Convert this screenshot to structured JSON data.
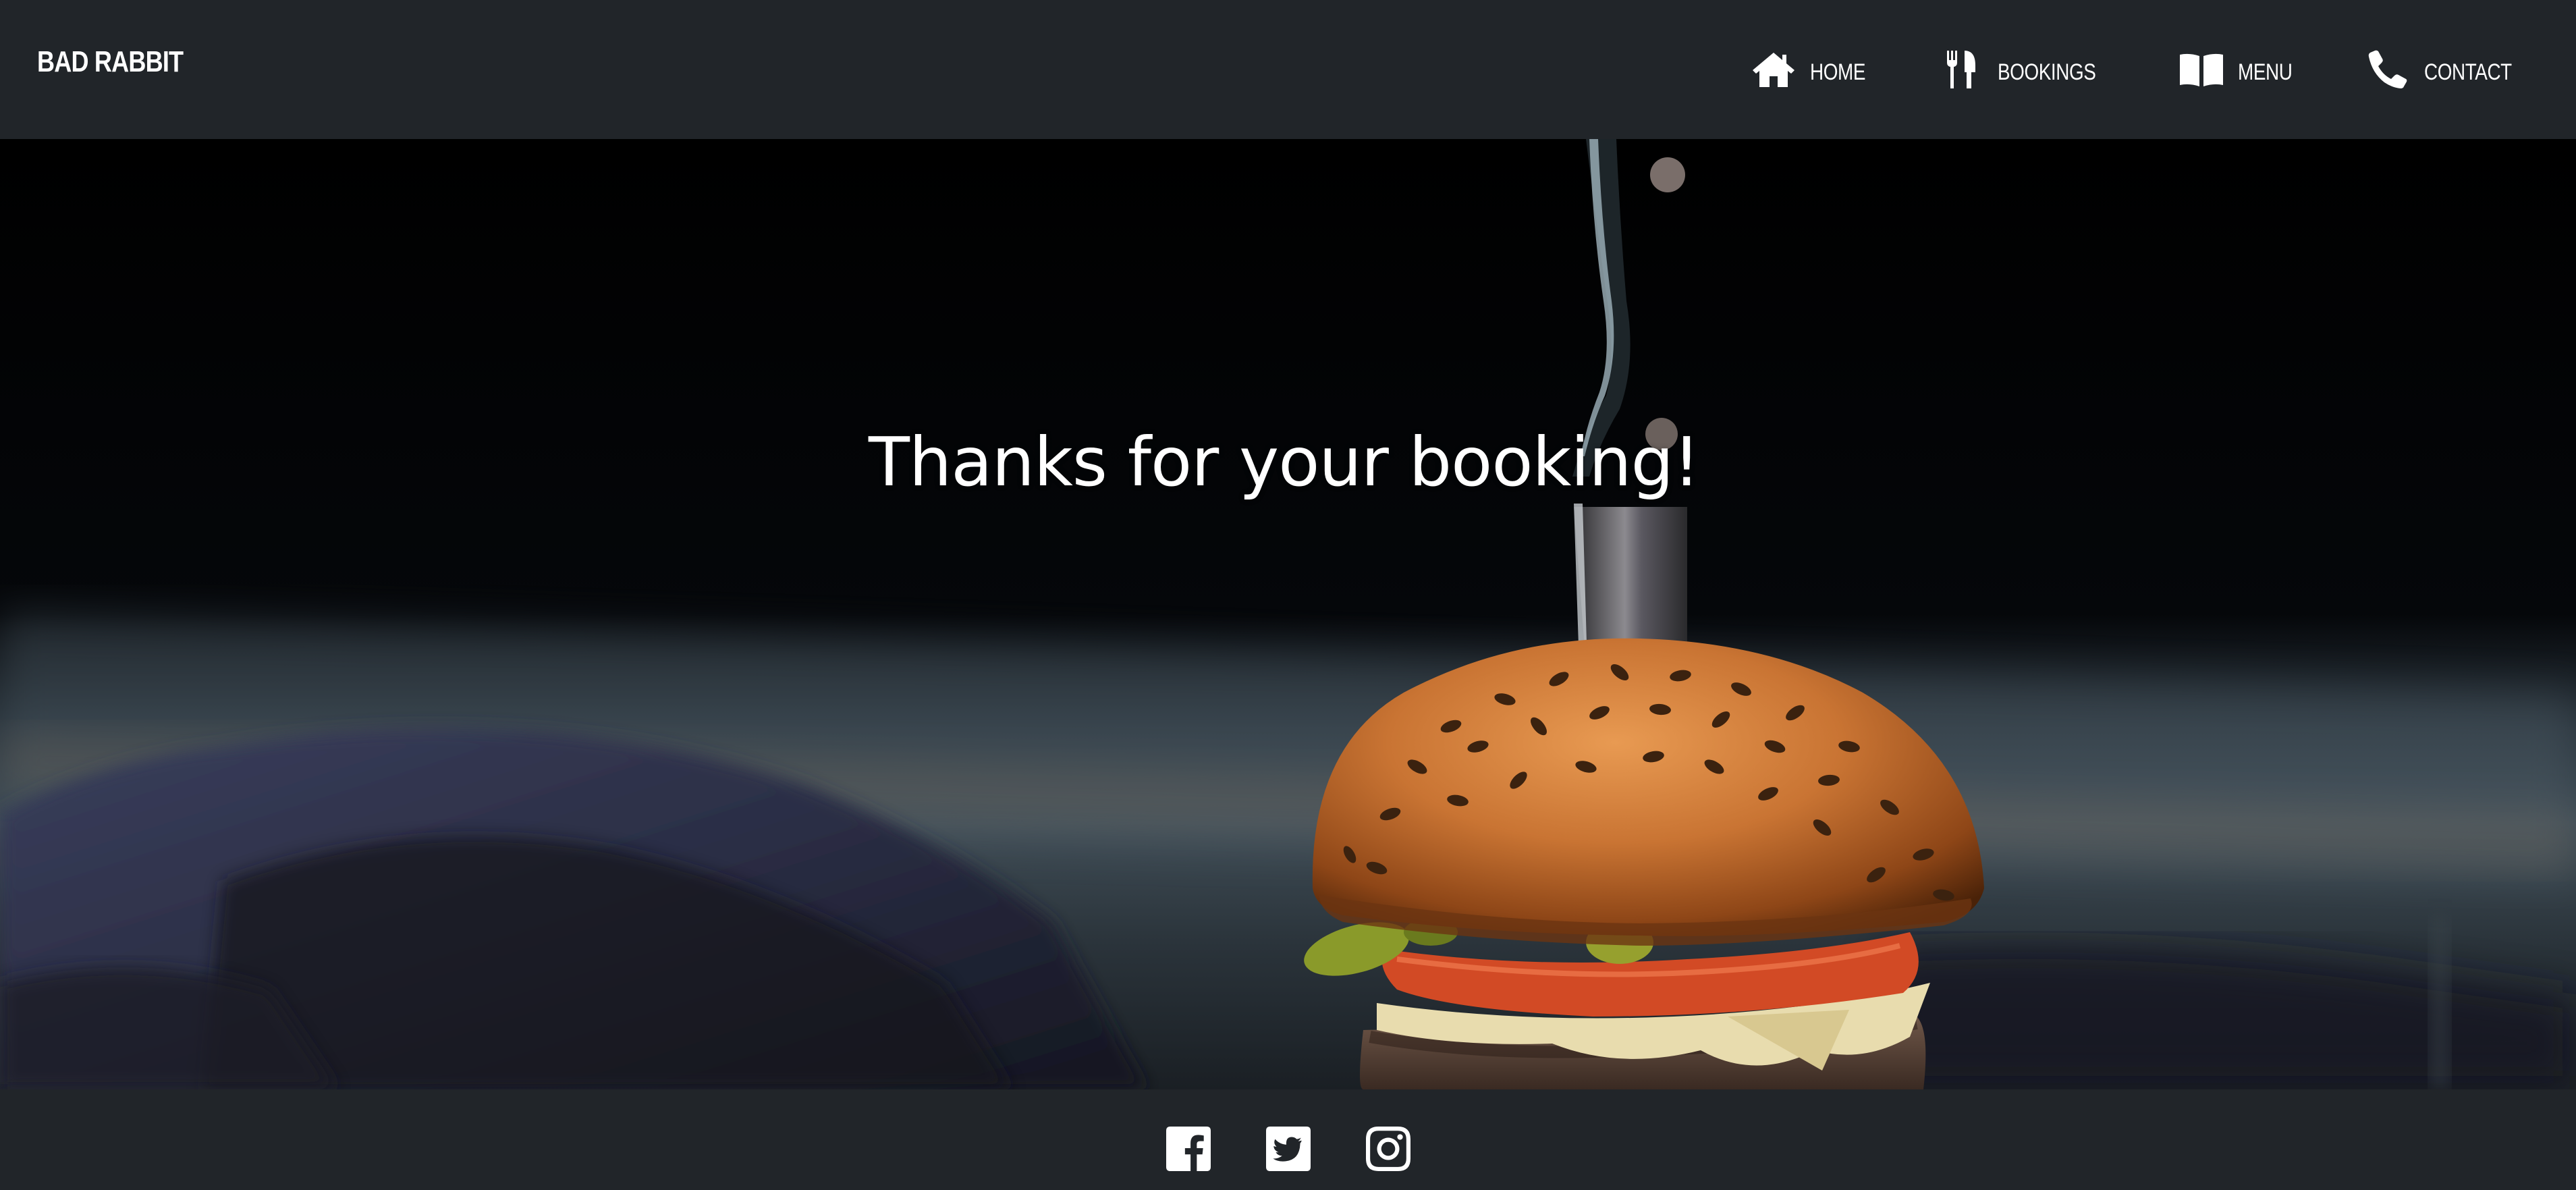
{
  "brand": {
    "name": "BAD RABBIT"
  },
  "nav": {
    "items": [
      {
        "label": "HOME",
        "icon": "home-icon"
      },
      {
        "label": "BOOKINGS",
        "icon": "utensils-icon"
      },
      {
        "label": "MENU",
        "icon": "book-open-icon"
      },
      {
        "label": "CONTACT",
        "icon": "phone-icon"
      }
    ]
  },
  "hero": {
    "heading": "Thanks for your booking!",
    "image": "burger-photo"
  },
  "footer": {
    "social": [
      {
        "icon": "facebook-icon"
      },
      {
        "icon": "twitter-icon"
      },
      {
        "icon": "instagram-icon"
      }
    ]
  },
  "colors": {
    "navbar_bg": "#212529",
    "text": "#ffffff",
    "hero_bg": "#000000"
  }
}
